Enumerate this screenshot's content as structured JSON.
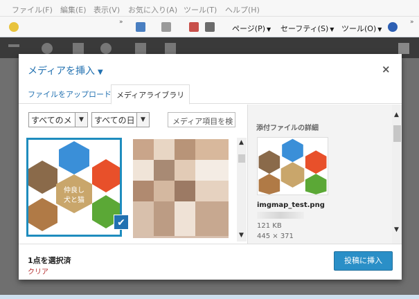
{
  "ie_menu": [
    "ファイル(F)",
    "編集(E)",
    "表示(V)",
    "お気に入り(A)",
    "ツール(T)",
    "ヘルプ(H)"
  ],
  "ie_toolbar": {
    "page": "ページ(P)",
    "safety": "セーフティ(S)",
    "tools": "ツール(O)",
    "overflow": "»"
  },
  "modal": {
    "title": "メディアを挿入",
    "close": "×",
    "tabs": [
      "ファイルをアップロード",
      "メディアライブラリ"
    ],
    "filters": {
      "type_select": "すべてのメ",
      "date_select": "すべての日",
      "search_placeholder": "メディア項目を検"
    },
    "details": {
      "heading": "添付ファイルの詳細",
      "filename": "imgmap_test.png",
      "filesize": "121 KB",
      "dimensions": "445 × 371"
    },
    "footer": {
      "selected_count": "1点を選択済",
      "clear": "クリア",
      "insert_button": "投稿に挿入"
    },
    "thumbnail_text": [
      "仲良し",
      "犬と猫"
    ]
  }
}
